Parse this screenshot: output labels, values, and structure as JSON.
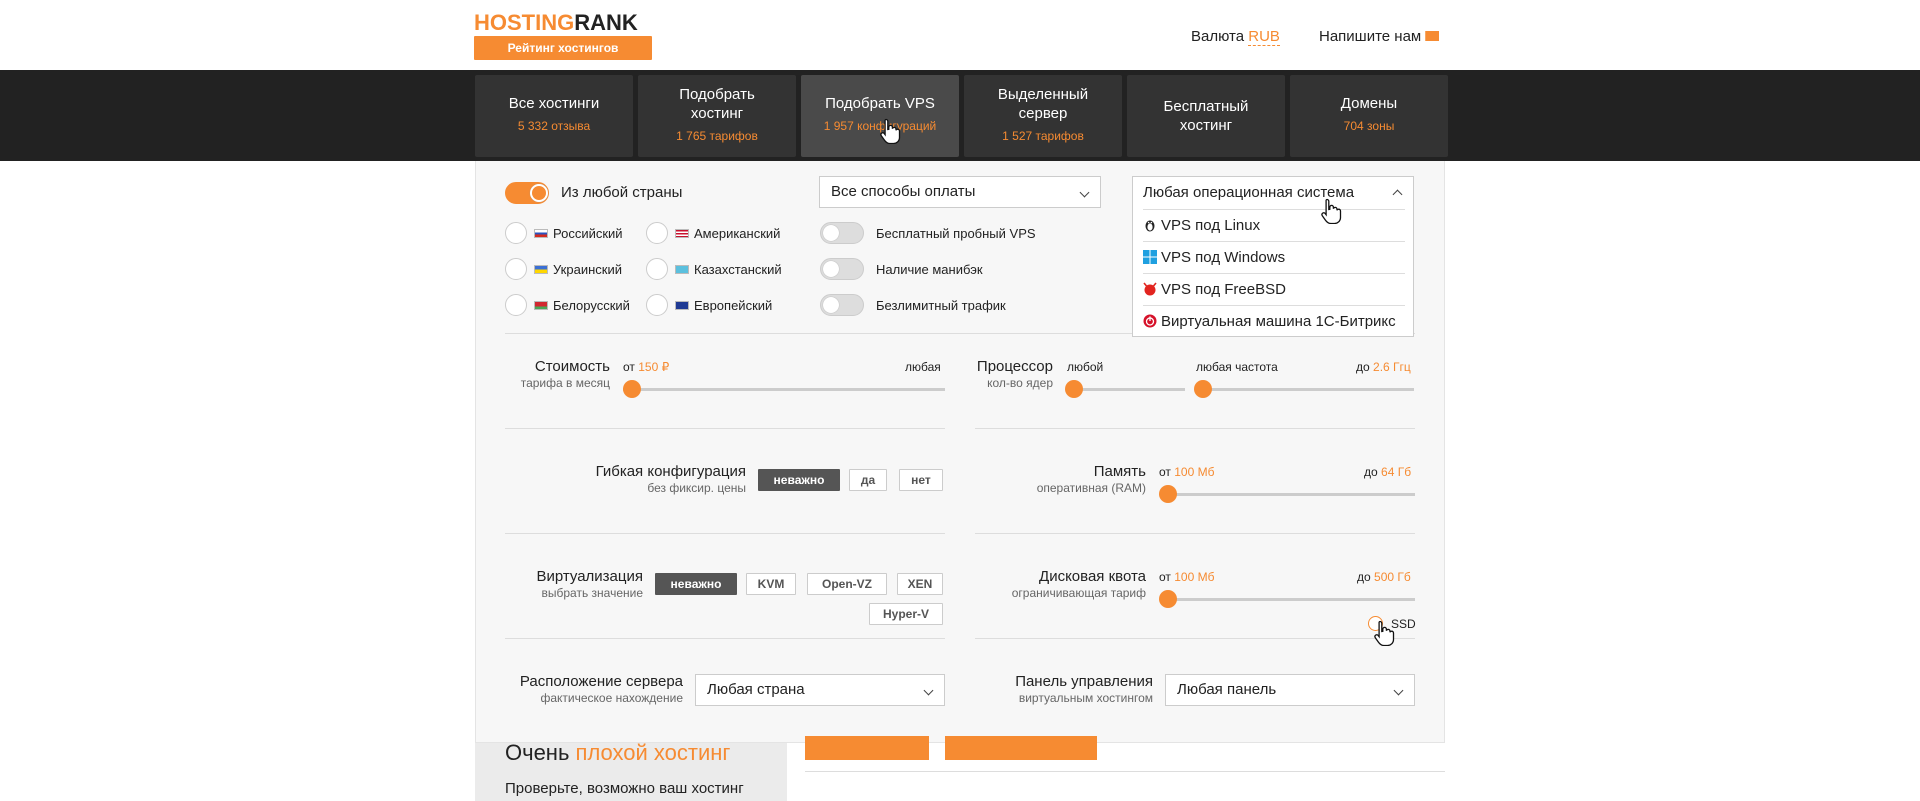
{
  "header": {
    "logo_part1": "HOSTING",
    "logo_part2": "RANK",
    "logo_sub": "Рейтинг хостингов",
    "currency_label": "Валюта",
    "currency_value": "RUB",
    "contact": "Напишите нам",
    "contact_icon": "envelope-icon"
  },
  "nav": {
    "tabs": [
      {
        "title": "Все хостинги",
        "sub": "5 332 отзыва"
      },
      {
        "title": "Подобрать хостинг",
        "sub": "1 765 тарифов"
      },
      {
        "title": "Подобрать VPS",
        "sub": "1 957 конфигураций"
      },
      {
        "title": "Выделенный сервер",
        "sub": "1 527 тарифов"
      },
      {
        "title": "Бесплатный хостинг",
        "sub": ""
      },
      {
        "title": "Домены",
        "sub": "704 зоны"
      }
    ]
  },
  "filters": {
    "any_country": "Из любой страны",
    "origins": [
      "Российский",
      "Американский",
      "Украинский",
      "Казахстанский",
      "Белорусский",
      "Европейский"
    ],
    "payment_select": "Все способы оплаты",
    "switches": [
      "Бесплатный пробный VPS",
      "Наличие манибэк",
      "Безлимитный трафик"
    ],
    "os_select": "Любая операционная система",
    "os_options": [
      {
        "label": "VPS под Linux",
        "icon": "linux-icon"
      },
      {
        "label": "VPS под Windows",
        "icon": "windows-icon"
      },
      {
        "label": "VPS под FreeBSD",
        "icon": "freebsd-icon"
      },
      {
        "label": "Виртуальная машина 1С-Битрикс",
        "icon": "bitrix-icon"
      }
    ],
    "cost": {
      "label": "Стоимость",
      "sub": "тарифа в месяц",
      "from_label": "от",
      "from_value": "150 ₽",
      "to_label": "любая"
    },
    "cpu": {
      "label": "Процессор",
      "sub": "кол-во ядер",
      "cores": "любой",
      "freq": "любая частота",
      "to_label": "до",
      "to_value": "2.6 Ггц"
    },
    "flex": {
      "label": "Гибкая конфигурация",
      "sub": "без фиксир. цены",
      "options": [
        "неважно",
        "да",
        "нет"
      ]
    },
    "memory": {
      "label": "Память",
      "sub": "оперативная (RAM)",
      "from_label": "от",
      "from_value": "100 Мб",
      "to_label": "до",
      "to_value": "64 Гб"
    },
    "virt": {
      "label": "Виртуализация",
      "sub": "выбрать значение",
      "options": [
        "неважно",
        "KVM",
        "Open-VZ",
        "XEN",
        "Hyper-V"
      ]
    },
    "disk": {
      "label": "Дисковая квота",
      "sub": "ограничивающая тариф",
      "from_label": "от",
      "from_value": "100 Мб",
      "to_label": "до",
      "to_value": "500 Гб",
      "ssd": "SSD"
    },
    "location": {
      "label": "Расположение сервера",
      "sub": "фактическое нахождение",
      "value": "Любая страна"
    },
    "panel": {
      "label": "Панель управления",
      "sub": "виртуальным хостингом",
      "value": "Любая панель"
    }
  },
  "below": {
    "title_part1": "Очень",
    "title_part2": "плохой хостинг",
    "text": "Проверьте, возможно ваш хостинг"
  },
  "colors": {
    "accent": "#f68b32",
    "dark": "#222222"
  }
}
